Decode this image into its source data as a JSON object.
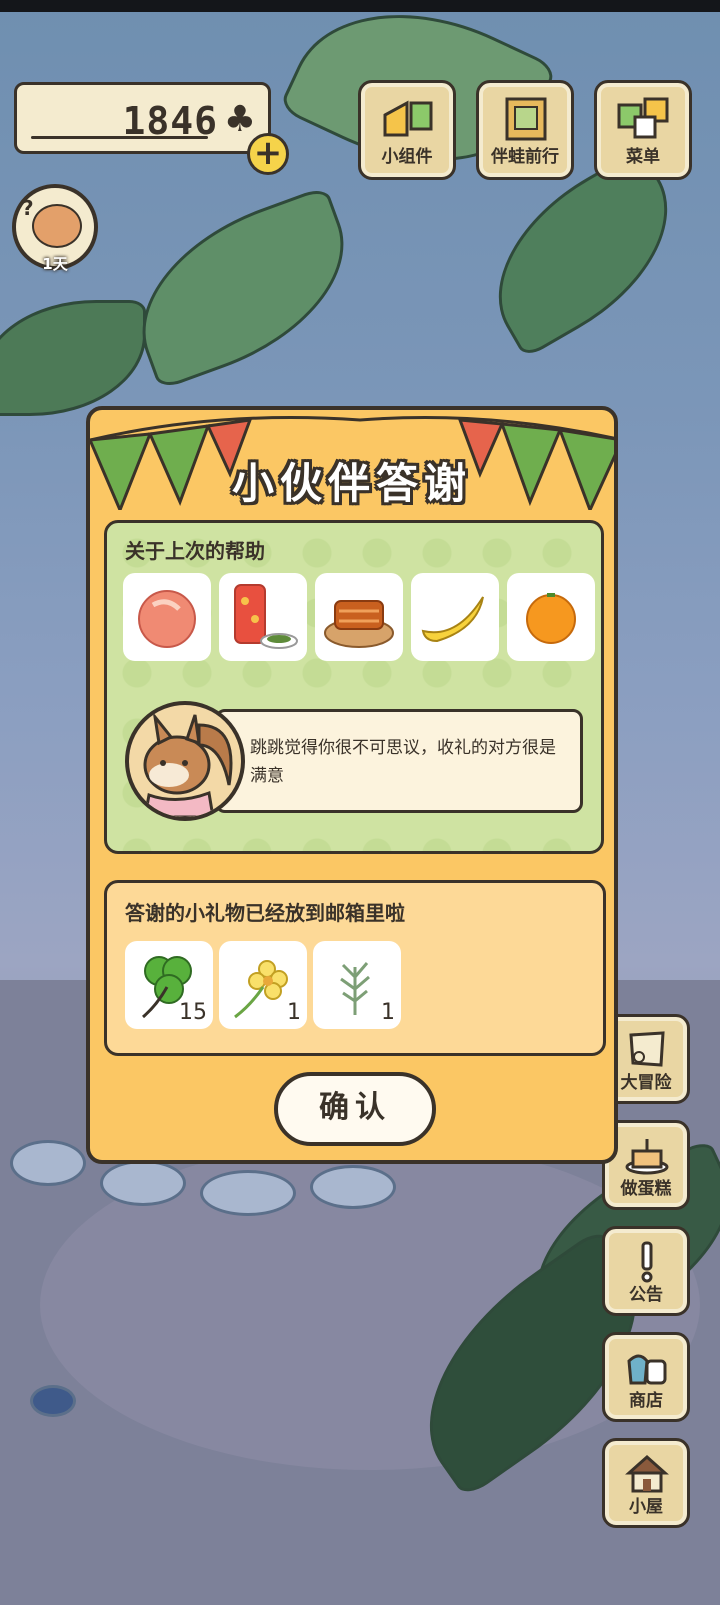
{
  "currency": {
    "amount": "1846",
    "symbol": "♣",
    "plus": "+"
  },
  "status": {
    "days": "1天",
    "mark": "?"
  },
  "top_buttons": [
    {
      "label": "小组件",
      "icon": "widget-icon"
    },
    {
      "label": "伴蛙前行",
      "icon": "journey-icon"
    },
    {
      "label": "菜单",
      "icon": "menu-icon"
    }
  ],
  "side_buttons": [
    {
      "label": "大冒险",
      "icon": "map-icon"
    },
    {
      "label": "做蛋糕",
      "icon": "cake-icon"
    },
    {
      "label": "公告",
      "icon": "notice-icon"
    },
    {
      "label": "商店",
      "icon": "shop-icon"
    },
    {
      "label": "小屋",
      "icon": "house-icon"
    }
  ],
  "dialog": {
    "title": "小伙伴答谢",
    "help_section_title": "关于上次的帮助",
    "help_items": [
      "peach-icon",
      "tea-tin-icon",
      "pastry-plate-icon",
      "banana-icon",
      "orange-icon"
    ],
    "message": "跳跳觉得你很不可思议，收礼的对方很是满意",
    "gift_section_title": "答谢的小礼物已经放到邮箱里啦",
    "gifts": [
      {
        "icon": "clover-icon",
        "qty": "15"
      },
      {
        "icon": "flower-icon",
        "qty": "1"
      },
      {
        "icon": "herb-icon",
        "qty": "1"
      }
    ],
    "confirm_label": "确认"
  },
  "colors": {
    "dialog_bg": "#fbc764",
    "help_bg": "#cfe3a2",
    "gift_bg": "#fdd997",
    "outline": "#3a3229"
  }
}
